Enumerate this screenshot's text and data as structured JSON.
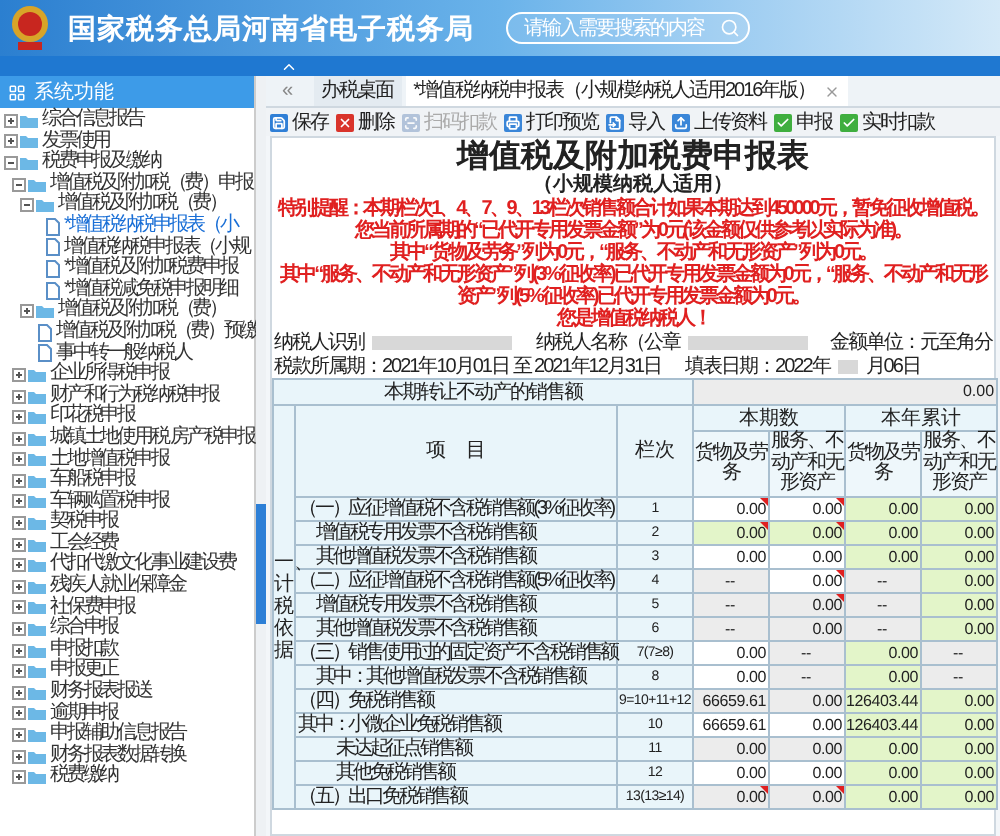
{
  "header": {
    "title": "国家税务总局河南省电子税务局",
    "search": {
      "placeholder": "请输入需要搜索的内容"
    }
  },
  "sidebar": {
    "title": "系统功能",
    "tree": [
      {
        "label": "综合信息报告",
        "kind": "folder",
        "expanded": false,
        "selected": false
      },
      {
        "label": "发票使用",
        "kind": "folder",
        "expanded": false,
        "selected": false
      },
      {
        "label": "税费申报及缴纳",
        "kind": "folder",
        "expanded": true,
        "selected": false,
        "children": [
          {
            "label": "增值税及附加税（费）申报",
            "kind": "folder",
            "expanded": true,
            "selected": false,
            "children": [
              {
                "label": "增值税及附加税（费）",
                "kind": "folder",
                "expanded": true,
                "selected": false,
                "children": [
                  {
                    "label": "*增值税纳税申报表（小",
                    "kind": "file",
                    "selected": true
                  },
                  {
                    "label": "增值税纳税申报表（小规",
                    "kind": "file",
                    "selected": false
                  },
                  {
                    "label": "*增值税及附加税费申报",
                    "kind": "file",
                    "selected": false
                  },
                  {
                    "label": "*增值税减免税申报明细",
                    "kind": "file",
                    "selected": false
                  }
                ]
              },
              {
                "label": "增值税及附加税（费）",
                "kind": "folder",
                "expanded": false,
                "selected": false
              },
              {
                "label": "增值税及附加税（费）预缴",
                "kind": "file",
                "selected": false
              },
              {
                "label": "事中转一般纳税人",
                "kind": "file",
                "selected": false
              }
            ]
          },
          {
            "label": "企业所得税申报",
            "kind": "folder",
            "expanded": false,
            "selected": false
          },
          {
            "label": "财产和行为税纳税申报",
            "kind": "folder",
            "expanded": false,
            "selected": false
          },
          {
            "label": "印花税申报",
            "kind": "folder",
            "expanded": false,
            "selected": false
          },
          {
            "label": "城镇土地使用税 房产税申报",
            "kind": "folder",
            "expanded": false,
            "selected": false
          },
          {
            "label": "土地增值税申报",
            "kind": "folder",
            "expanded": false,
            "selected": false
          },
          {
            "label": "车船税申报",
            "kind": "folder",
            "expanded": false,
            "selected": false
          },
          {
            "label": "车辆购置税申报",
            "kind": "folder",
            "expanded": false,
            "selected": false
          },
          {
            "label": "契税申报",
            "kind": "folder",
            "expanded": false,
            "selected": false
          },
          {
            "label": "工会经费",
            "kind": "folder",
            "expanded": false,
            "selected": false
          },
          {
            "label": "代扣代缴文化事业建设费",
            "kind": "folder",
            "expanded": false,
            "selected": false
          },
          {
            "label": "残疾人就业保障金",
            "kind": "folder",
            "expanded": false,
            "selected": false
          },
          {
            "label": "社保费申报",
            "kind": "folder",
            "expanded": false,
            "selected": false
          },
          {
            "label": "综合申报",
            "kind": "folder",
            "expanded": false,
            "selected": false
          },
          {
            "label": "申报扣款",
            "kind": "folder",
            "expanded": false,
            "selected": false
          },
          {
            "label": "申报更正",
            "kind": "folder",
            "expanded": false,
            "selected": false
          },
          {
            "label": "财务报表报送",
            "kind": "folder",
            "expanded": false,
            "selected": false
          },
          {
            "label": "逾期申报",
            "kind": "folder",
            "expanded": false,
            "selected": false
          },
          {
            "label": "申报辅助信息报告",
            "kind": "folder",
            "expanded": false,
            "selected": false
          },
          {
            "label": "财务报表数据转换",
            "kind": "folder",
            "expanded": false,
            "selected": false
          },
          {
            "label": "税费缴纳",
            "kind": "folder",
            "expanded": false,
            "selected": false
          }
        ]
      }
    ]
  },
  "tabs": {
    "back": "«",
    "items": [
      {
        "label": "办税桌面",
        "selected": false,
        "closable": false
      },
      {
        "label": "*增值税纳税申报表（小规模纳税人适用2016年版）",
        "selected": true,
        "closable": true
      }
    ]
  },
  "toolbar": [
    {
      "label": "保存",
      "kind": "save",
      "disabled": false
    },
    {
      "label": "删除",
      "kind": "delete",
      "disabled": false
    },
    {
      "label": "扫码扣款",
      "kind": "scan",
      "disabled": true
    },
    {
      "label": "打印预览",
      "kind": "print",
      "disabled": false
    },
    {
      "label": "导入",
      "kind": "import",
      "disabled": false
    },
    {
      "label": "上传资料",
      "kind": "upload",
      "disabled": false
    },
    {
      "label": "申报",
      "kind": "submit",
      "disabled": false
    },
    {
      "label": "实时扣款",
      "kind": "deduct",
      "disabled": false
    }
  ],
  "form": {
    "title": "增值税及附加税费申报表",
    "subtitle": "（小规模纳税人适用）",
    "notice": [
      "特别提醒：本期栏次1、4、7、9、13栏次销售额合计如果本期达到450000元，暂免征收增值税。",
      "您当前所属期的“已代开专用发票金额”为0元(该金额仅供参考以实际为准)。",
      "其中“货物及劳务”列为0元，“服务、不动产和无形资产”列为0元。",
      "其中“服务、不动产和无形资产”列(3%征收率)已代开专用发票金额为0元，“服务、不动产和无形资产”列(5%征收率)已代开专用发票金额为0元。",
      "您是增值税纳税人！"
    ],
    "taxpayer_id_label": "纳税人识别",
    "taxpayer_name_label": "纳税人名称（公章",
    "unit": "金额单位：元至角分",
    "period": "税款所属期：2021年10月01日 至 2021年12月31日",
    "fill_date_start": "填表日期：2022年",
    "fill_date_end": "月06日"
  },
  "table": {
    "transfer_row": {
      "label": "本期转让不动产的销售额",
      "value": "0.00"
    },
    "side_label": "一、计税依据",
    "item_header": "项　目",
    "line_header": "栏次",
    "groups": [
      {
        "label": "本期数",
        "sub": [
          "货物及劳务",
          "服务、不动产和无形资产"
        ]
      },
      {
        "label": "本年累计",
        "sub": [
          "货物及劳务",
          "服务、不动产和无形资产"
        ]
      }
    ],
    "rows": [
      {
        "item": "（一）应征增值税不含税销售额(3%征收率)",
        "kind": "heading",
        "line": "1",
        "cells": [
          {
            "value": "0.00",
            "kind": "white",
            "flag": true
          },
          {
            "value": "0.00",
            "kind": "white",
            "flag": true
          },
          {
            "value": "0.00",
            "kind": "green",
            "flag": false
          },
          {
            "value": "0.00",
            "kind": "green",
            "flag": false
          }
        ]
      },
      {
        "item": "增值税专用发票不含税销售额",
        "kind": "sub",
        "line": "2",
        "cells": [
          {
            "value": "0.00",
            "kind": "green",
            "flag": true
          },
          {
            "value": "0.00",
            "kind": "green",
            "flag": true
          },
          {
            "value": "0.00",
            "kind": "green",
            "flag": false
          },
          {
            "value": "0.00",
            "kind": "green",
            "flag": false
          }
        ]
      },
      {
        "item": "其他增值税发票不含税销售额",
        "kind": "sub",
        "line": "3",
        "cells": [
          {
            "value": "0.00",
            "kind": "white",
            "flag": false
          },
          {
            "value": "0.00",
            "kind": "white",
            "flag": false
          },
          {
            "value": "0.00",
            "kind": "green",
            "flag": false
          },
          {
            "value": "0.00",
            "kind": "green",
            "flag": false
          }
        ]
      },
      {
        "item": "（二）应征增值税不含税销售额(5%征收率)",
        "kind": "heading",
        "line": "4",
        "cells": [
          {
            "value": "--",
            "kind": "blank",
            "flag": false
          },
          {
            "value": "0.00",
            "kind": "white",
            "flag": true
          },
          {
            "value": "--",
            "kind": "blank",
            "flag": false
          },
          {
            "value": "0.00",
            "kind": "green",
            "flag": false
          }
        ]
      },
      {
        "item": "增值税专用发票不含税销售额",
        "kind": "sub",
        "line": "5",
        "cells": [
          {
            "value": "--",
            "kind": "blank",
            "flag": false
          },
          {
            "value": "0.00",
            "kind": "gray",
            "flag": true
          },
          {
            "value": "--",
            "kind": "blank",
            "flag": false
          },
          {
            "value": "0.00",
            "kind": "green",
            "flag": false
          }
        ]
      },
      {
        "item": "其他增值税发票不含税销售额",
        "kind": "sub",
        "line": "6",
        "cells": [
          {
            "value": "--",
            "kind": "blank",
            "flag": false
          },
          {
            "value": "0.00",
            "kind": "gray",
            "flag": false
          },
          {
            "value": "--",
            "kind": "blank",
            "flag": false
          },
          {
            "value": "0.00",
            "kind": "green",
            "flag": false
          }
        ]
      },
      {
        "item": "（三）销售使用过的固定资产不含税销售额",
        "kind": "heading",
        "line": "7(7≥8)",
        "cells": [
          {
            "value": "0.00",
            "kind": "white",
            "flag": false
          },
          {
            "value": "--",
            "kind": "blank",
            "flag": false
          },
          {
            "value": "0.00",
            "kind": "green",
            "flag": false
          },
          {
            "value": "--",
            "kind": "blank",
            "flag": false
          }
        ]
      },
      {
        "item": "其中：其他增值税发票不含税销售额",
        "kind": "sub",
        "line": "8",
        "cells": [
          {
            "value": "0.00",
            "kind": "white",
            "flag": false
          },
          {
            "value": "--",
            "kind": "blank",
            "flag": false
          },
          {
            "value": "0.00",
            "kind": "green",
            "flag": false
          },
          {
            "value": "--",
            "kind": "blank",
            "flag": false
          }
        ]
      },
      {
        "item": "（四）免税销售额",
        "kind": "heading",
        "line": "9=10+11+12",
        "cells": [
          {
            "value": "66659.61",
            "kind": "gray",
            "flag": false
          },
          {
            "value": "0.00",
            "kind": "gray",
            "flag": false
          },
          {
            "value": "126403.44",
            "kind": "green",
            "flag": false
          },
          {
            "value": "0.00",
            "kind": "green",
            "flag": false
          }
        ]
      },
      {
        "item": "其中：小微企业免税销售额",
        "kind": "heading",
        "line": "10",
        "cells": [
          {
            "value": "66659.61",
            "kind": "white",
            "flag": false
          },
          {
            "value": "0.00",
            "kind": "white",
            "flag": false
          },
          {
            "value": "126403.44",
            "kind": "green",
            "flag": false
          },
          {
            "value": "0.00",
            "kind": "green",
            "flag": false
          }
        ]
      },
      {
        "item": "未达起征点销售额",
        "kind": "detail",
        "line": "11",
        "cells": [
          {
            "value": "0.00",
            "kind": "gray",
            "flag": false
          },
          {
            "value": "0.00",
            "kind": "gray",
            "flag": false
          },
          {
            "value": "0.00",
            "kind": "green",
            "flag": false
          },
          {
            "value": "0.00",
            "kind": "green",
            "flag": false
          }
        ]
      },
      {
        "item": "其他免税销售额",
        "kind": "detail",
        "line": "12",
        "cells": [
          {
            "value": "0.00",
            "kind": "white",
            "flag": false
          },
          {
            "value": "0.00",
            "kind": "white",
            "flag": false
          },
          {
            "value": "0.00",
            "kind": "green",
            "flag": false
          },
          {
            "value": "0.00",
            "kind": "green",
            "flag": false
          }
        ]
      },
      {
        "item": "（五）出口免税销售额",
        "kind": "heading",
        "line": "13(13≥14)",
        "cells": [
          {
            "value": "0.00",
            "kind": "gray",
            "flag": true
          },
          {
            "value": "0.00",
            "kind": "gray",
            "flag": true
          },
          {
            "value": "0.00",
            "kind": "green",
            "flag": false
          },
          {
            "value": "0.00",
            "kind": "green",
            "flag": false
          }
        ]
      }
    ]
  }
}
